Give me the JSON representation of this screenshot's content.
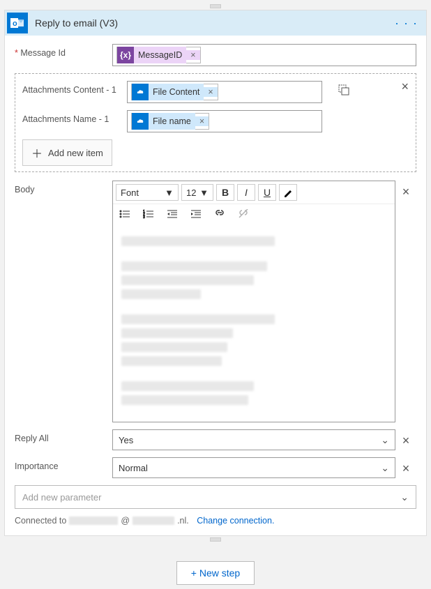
{
  "header": {
    "title": "Reply to email (V3)",
    "icon_text": "o✉"
  },
  "fields": {
    "messageId": {
      "label": "Message Id",
      "required": true,
      "token": "MessageID"
    },
    "attachmentsContent": {
      "label": "Attachments Content - 1",
      "token": "File Content"
    },
    "attachmentsName": {
      "label": "Attachments Name - 1",
      "token": "File name"
    },
    "addNewItem": "Add new item",
    "body": {
      "label": "Body"
    },
    "replyAll": {
      "label": "Reply All",
      "value": "Yes"
    },
    "importance": {
      "label": "Importance",
      "value": "Normal"
    },
    "addParam": "Add new parameter"
  },
  "rte": {
    "font_label": "Font",
    "size_label": "12"
  },
  "connection": {
    "prefix": "Connected to",
    "domain_suffix": ".nl.",
    "change": "Change connection."
  },
  "newStep": "+ New step"
}
